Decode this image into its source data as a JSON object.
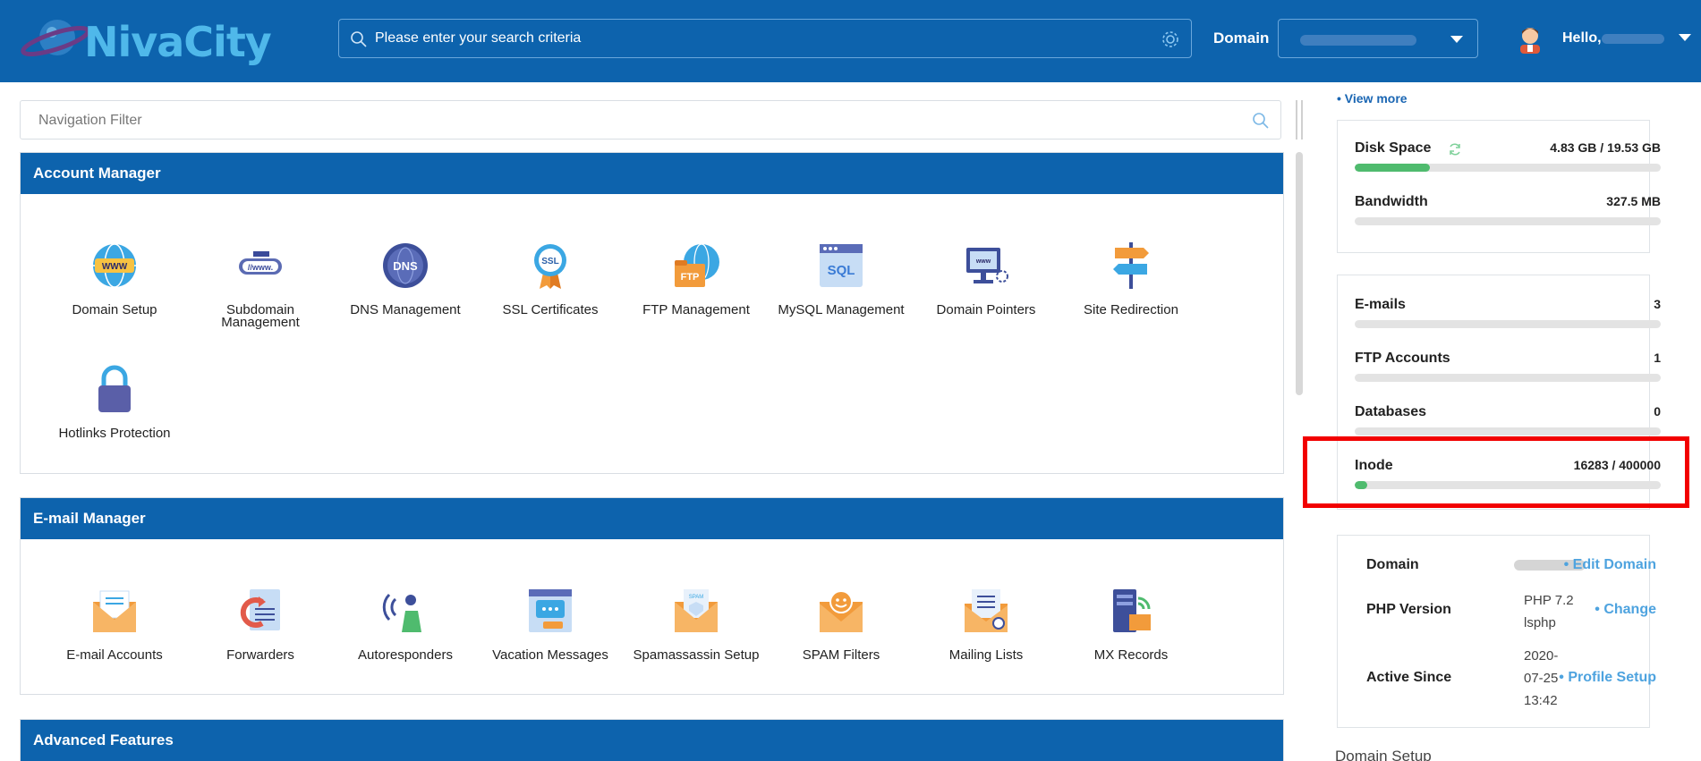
{
  "header": {
    "logo_text": "NivaCity",
    "search_placeholder": "Please enter your search criteria",
    "domain_label": "Domain",
    "greeting": "Hello,"
  },
  "nav": {
    "filter_placeholder": "Navigation Filter"
  },
  "account_manager": {
    "title": "Account Manager",
    "items": [
      {
        "label": "Domain Setup",
        "icon": "domain-setup-icon"
      },
      {
        "label": "Subdomain Management",
        "icon": "subdomain-icon"
      },
      {
        "label": "DNS Management",
        "icon": "dns-icon"
      },
      {
        "label": "SSL Certificates",
        "icon": "ssl-icon"
      },
      {
        "label": "FTP Management",
        "icon": "ftp-icon"
      },
      {
        "label": "MySQL Management",
        "icon": "mysql-icon"
      },
      {
        "label": "Domain Pointers",
        "icon": "domain-pointers-icon"
      },
      {
        "label": "Site Redirection",
        "icon": "site-redirection-icon"
      },
      {
        "label": "Hotlinks Protection",
        "icon": "lock-icon"
      }
    ]
  },
  "email_manager": {
    "title": "E-mail Manager",
    "items": [
      {
        "label": "E-mail Accounts",
        "icon": "email-accounts-icon"
      },
      {
        "label": "Forwarders",
        "icon": "forwarders-icon"
      },
      {
        "label": "Autoresponders",
        "icon": "autoresponders-icon"
      },
      {
        "label": "Vacation Messages",
        "icon": "vacation-icon"
      },
      {
        "label": "Spamassassin Setup",
        "icon": "spamassassin-icon"
      },
      {
        "label": "SPAM Filters",
        "icon": "spam-filters-icon"
      },
      {
        "label": "Mailing Lists",
        "icon": "mailing-lists-icon"
      },
      {
        "label": "MX Records",
        "icon": "mx-records-icon"
      }
    ]
  },
  "advanced": {
    "title": "Advanced Features"
  },
  "sidebar": {
    "view_more": "• View more",
    "usage": [
      {
        "name": "Disk Space",
        "value": "4.83 GB / 19.53 GB",
        "fraction": 0.247
      },
      {
        "name": "Bandwidth",
        "value": "327.5 MB",
        "fraction": 0
      }
    ],
    "counts": [
      {
        "name": "E-mails",
        "value": "3",
        "fraction": 0
      },
      {
        "name": "FTP Accounts",
        "value": "1",
        "fraction": 0
      },
      {
        "name": "Databases",
        "value": "0",
        "fraction": 0
      },
      {
        "name": "Inode",
        "value": "16283 / 400000",
        "fraction": 0.041
      }
    ],
    "info": {
      "domain_key": "Domain",
      "domain_action": "• Edit Domain",
      "php_key": "PHP Version",
      "php_value_1": "PHP 7.2",
      "php_value_2": "lsphp",
      "php_action": "• Change",
      "active_key": "Active Since",
      "active_value_1": "2020-",
      "active_value_2": "07-25",
      "active_value_3": "13:42",
      "active_action": "• Profile Setup"
    },
    "bottom_section": "Domain Setup",
    "bottom_chevron": "⌄"
  },
  "colors": {
    "primary": "#0d63ad",
    "accent": "#4ea3df",
    "bar_fill": "#4fbb6e",
    "highlight": "#f20000"
  }
}
